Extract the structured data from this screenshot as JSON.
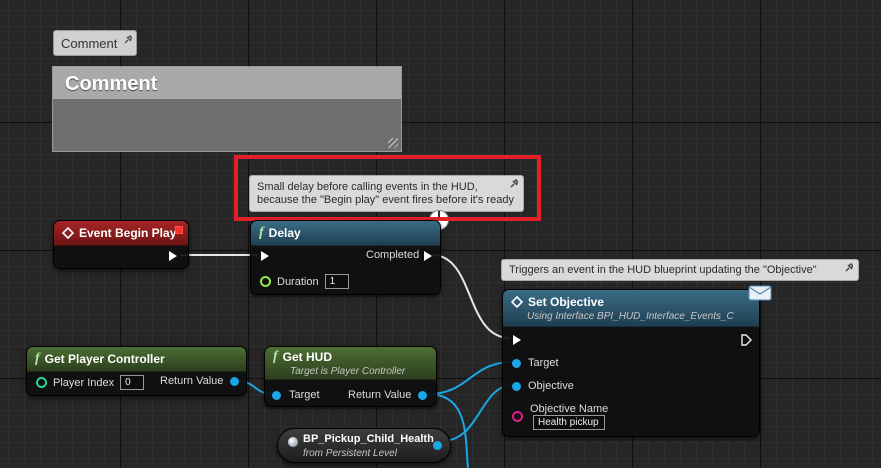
{
  "comment": {
    "tab_label": "Comment",
    "box_title": "Comment"
  },
  "bubbles": {
    "delay_note_line1": "Small delay before calling events in the HUD,",
    "delay_note_line2": "because the \"Begin play\" event fires before it's ready",
    "objective_note": "Triggers an event in the HUD blueprint updating the \"Objective\" variable"
  },
  "nodes": {
    "event_begin_play": {
      "title": "Event Begin Play"
    },
    "delay": {
      "title": "Delay",
      "out_label": "Completed",
      "duration_label": "Duration",
      "duration_value": "1"
    },
    "set_objective": {
      "title": "Set Objective",
      "subtitle": "Using Interface BPI_HUD_Interface_Events_C",
      "target_label": "Target",
      "objective_label": "Objective",
      "objective_name_label": "Objective Name",
      "objective_name_value": "Health pickup"
    },
    "get_player_controller": {
      "title": "Get Player Controller",
      "player_index_label": "Player Index",
      "player_index_value": "0",
      "return_label": "Return Value"
    },
    "get_hud": {
      "title": "Get HUD",
      "subtitle": "Target is Player Controller",
      "target_label": "Target",
      "return_label": "Return Value"
    },
    "pickup_ref": {
      "title": "BP_Pickup_Child_Health",
      "subtitle": "from Persistent Level"
    }
  },
  "colors": {
    "event_header": "#8b1c1c",
    "function_header": "#2a5568",
    "pure_header": "#3f5b28",
    "object_pin": "#1aa7e6",
    "string_pin": "#e61a8f",
    "int_pin": "#1fd6a0",
    "highlight": "#e3202a"
  }
}
